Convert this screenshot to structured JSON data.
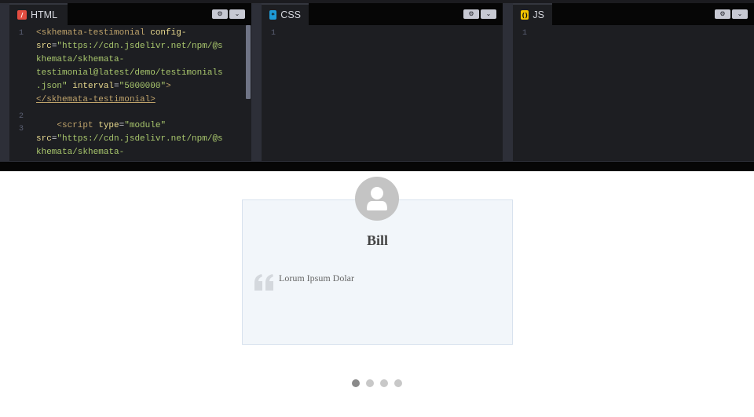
{
  "editors": {
    "html": {
      "tab_label": "HTML",
      "icon": "html-icon",
      "lines": {
        "l1_tag_open": "<skhemata-testimonial",
        "l1_attr1": "config-",
        "l1_attr1b": "src",
        "l1_eq": "=",
        "l1_str1a": "\"https://cdn.jsdelivr.net/npm/@s",
        "l1_str1b": "khemata/skhemata-",
        "l1_str1c": "testimonial@latest/demo/testimonials",
        "l1_str1d": ".json\"",
        "l1_attr2": "interval",
        "l1_str2": "\"5000000\"",
        "l1_close": ">",
        "l1_tag_close": "</skhemata-testimonial>",
        "l3_tag": "<script",
        "l3_attr1": "type",
        "l3_str1": "\"module\"",
        "l3_attr2": "src",
        "l3_str2a": "\"https://cdn.jsdelivr.net/npm/@s",
        "l3_str2b": "khemata/skhemata-"
      },
      "line_numbers": [
        "1",
        "2",
        "3"
      ]
    },
    "css": {
      "tab_label": "CSS",
      "icon": "css-icon",
      "line_numbers": [
        "1"
      ]
    },
    "js": {
      "tab_label": "JS",
      "icon": "js-icon",
      "line_numbers": [
        "1"
      ]
    },
    "settings_glyph": "⚙",
    "chevron_glyph": "⌄",
    "colors": {
      "html_icon": "#e44d41",
      "css_icon": "#1e9bd7",
      "js_icon": "#f2c500"
    }
  },
  "testimonial": {
    "name": "Bill",
    "quote": "Lorum Ipsum Dolar",
    "slides_total": 4,
    "active_slide": 1
  }
}
